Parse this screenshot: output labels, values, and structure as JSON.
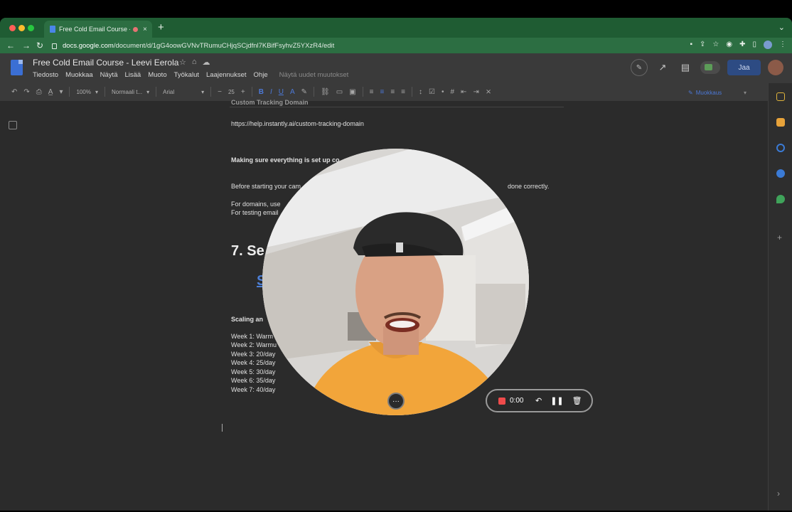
{
  "browser": {
    "tab_title": "Free Cold Email Course - L",
    "new_tab": "+",
    "tab_close": "×",
    "url_domain": "docs.google.com",
    "url_path": "/document/d/1gG4oowGVNvTRumuCHjqSCjdfnl7KBifFsyhvZ5YXzR4/edit"
  },
  "docs": {
    "title": "Free Cold Email Course - Leevi Eerola",
    "menus": [
      "Tiedosto",
      "Muokkaa",
      "Näytä",
      "Lisää",
      "Muoto",
      "Työkalut",
      "Laajennukset",
      "Ohje"
    ],
    "last_edit": "Näytä uudet muutokset",
    "share_label": "Jaa",
    "toolbar": {
      "zoom": "100%",
      "style": "Normaali t...",
      "font": "Arial",
      "font_size": "25",
      "minus": "−",
      "plus": "+",
      "mode": "Muokkaus"
    }
  },
  "document": {
    "tracking_heading": "Custom Tracking Domain",
    "tracking_url": "https://help.instantly.ai/custom-tracking-domain",
    "setup_heading": "Making sure everything is set up co",
    "before_text": "Before starting your cam",
    "before_text_end": "done correctly.",
    "domains_text": "For domains, use",
    "testing_text": "For testing email",
    "section_heading": "7. Se",
    "section_link": "S",
    "scaling_heading": "Scaling an",
    "weeks": [
      "Week 1: Warm",
      "Week 2: Warmu",
      "Week 3: 20/day",
      "Week 4: 25/day",
      "Week 5: 30/day",
      "Week 6: 35/day",
      "Week 7: 40/day"
    ]
  },
  "recorder": {
    "time": "0:00",
    "more": "···"
  },
  "colors": {
    "chrome_green": "#1f5c33",
    "share_blue": "#2d4b83",
    "record_red": "#f04b4b",
    "link_blue": "#4d7fd6"
  }
}
